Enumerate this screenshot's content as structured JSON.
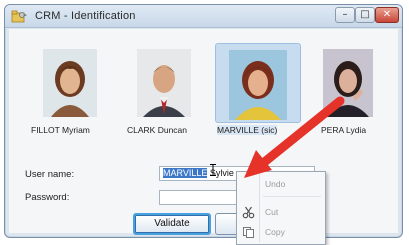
{
  "window": {
    "title": "CRM - Identification",
    "app_icon": "key-folder-icon",
    "min_glyph": "–",
    "max_glyph": "□",
    "close_glyph": "✕"
  },
  "photos": [
    {
      "name": "FILLOT Myriam",
      "icon": "portrait-icon",
      "selected": false
    },
    {
      "name": "CLARK Duncan",
      "icon": "portrait-icon",
      "selected": false
    },
    {
      "name": "MARVILLE (sic)",
      "icon": "portrait-icon",
      "selected": true
    },
    {
      "name": "PERA Lydia",
      "icon": "portrait-icon",
      "selected": false
    }
  ],
  "form": {
    "username_label": "User name:",
    "username_value_selected": "MARVILLE",
    "username_value_rest": " Sylvie",
    "password_label": "Password:",
    "password_value": ""
  },
  "buttons": {
    "validate_label": "Validate",
    "cancel_label": ""
  },
  "context_menu": {
    "items": [
      {
        "label": "Undo",
        "icon": ""
      },
      {
        "label": "Cut",
        "icon": "scissors-icon"
      },
      {
        "label": "Copy",
        "icon": "copy-icon"
      }
    ]
  },
  "annotation": {
    "arrow_color": "#e5332a"
  }
}
